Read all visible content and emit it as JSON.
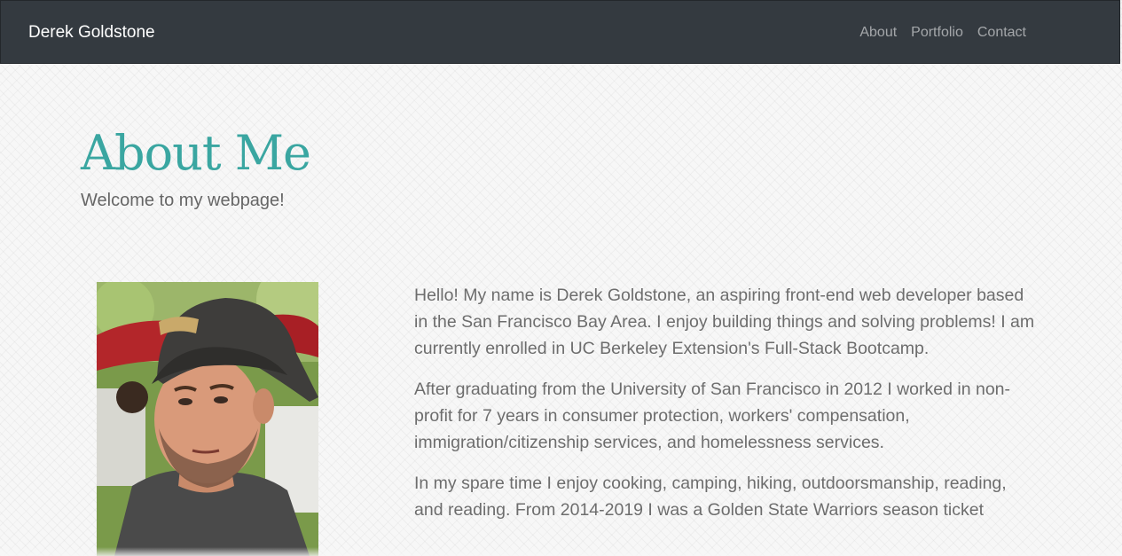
{
  "navbar": {
    "brand": "Derek Goldstone",
    "links": [
      "About",
      "Portfolio",
      "Contact"
    ]
  },
  "hero": {
    "title": "About Me",
    "subtitle": "Welcome to my webpage!"
  },
  "bio": {
    "paragraphs": [
      "Hello! My name is Derek Goldstone, an aspiring front-end web developer based in the San Francisco Bay Area. I enjoy building things and solving problems! I am currently enrolled in UC Berkeley Extension's Full-Stack Bootcamp.",
      "After graduating from the University of San Francisco in 2012 I worked in non-profit for 7 years in consumer protection, workers' compensation, immigration/citizenship services, and homelessness services.",
      "In my spare time I enjoy cooking, camping, hiking, outdoorsmanship, reading, and reading. From 2014-2019 I was a Golden State Warriors season ticket"
    ]
  },
  "colors": {
    "navbar_bg": "#343a40",
    "title": "#3aa6a1",
    "body_text": "#6d6d6d"
  }
}
